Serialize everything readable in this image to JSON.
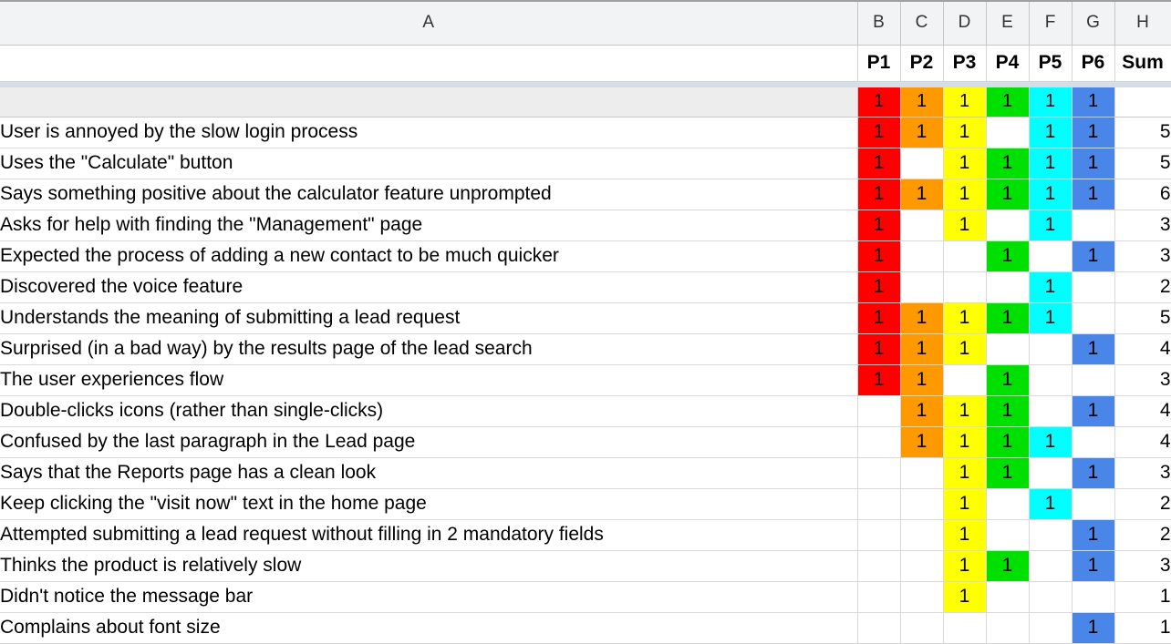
{
  "spreadsheet": {
    "column_letters": [
      "A",
      "B",
      "C",
      "D",
      "E",
      "F",
      "G",
      "H"
    ],
    "headers": {
      "label_column": "",
      "participants": [
        "P1",
        "P2",
        "P3",
        "P4",
        "P5",
        "P6"
      ],
      "sum": "Sum"
    },
    "legend_row": {
      "label": "",
      "marks": [
        "1",
        "1",
        "1",
        "1",
        "1",
        "1"
      ],
      "sum": ""
    },
    "mark_value": "1",
    "colors": {
      "p1": "#ff0000",
      "p2": "#ff9900",
      "p3": "#ffff00",
      "p4": "#00e000",
      "p5": "#00ffff",
      "p6": "#4a86e8",
      "column_header_bg": "#f1f3f4",
      "band": "#d8dce5",
      "legend_label_bg": "#ededed",
      "grid_line": "#d9d9d9"
    },
    "rows": [
      {
        "label": "User is annoyed by the slow login process",
        "marks": [
          "1",
          "1",
          "1",
          "",
          "1",
          "1"
        ],
        "sum": "5"
      },
      {
        "label": "Uses the \"Calculate\" button",
        "marks": [
          "1",
          "",
          "1",
          "1",
          "1",
          "1"
        ],
        "sum": "5"
      },
      {
        "label": "Says something positive about the calculator feature unprompted",
        "marks": [
          "1",
          "1",
          "1",
          "1",
          "1",
          "1"
        ],
        "sum": "6"
      },
      {
        "label": "Asks for help with finding the \"Management\" page",
        "marks": [
          "1",
          "",
          "1",
          "",
          "1",
          ""
        ],
        "sum": "3"
      },
      {
        "label": "Expected the process of adding a new contact to be much quicker",
        "marks": [
          "1",
          "",
          "",
          "1",
          "",
          "1"
        ],
        "sum": "3"
      },
      {
        "label": "Discovered the voice feature",
        "marks": [
          "1",
          "",
          "",
          "",
          "1",
          ""
        ],
        "sum": "2"
      },
      {
        "label": "Understands the meaning of submitting a lead request",
        "marks": [
          "1",
          "1",
          "1",
          "1",
          "1",
          ""
        ],
        "sum": "5"
      },
      {
        "label": "Surprised (in a bad way) by the results page of the lead search",
        "marks": [
          "1",
          "1",
          "1",
          "",
          "",
          "1"
        ],
        "sum": "4"
      },
      {
        "label": "The user experiences flow",
        "marks": [
          "1",
          "1",
          "",
          "1",
          "",
          ""
        ],
        "sum": "3"
      },
      {
        "label": "Double-clicks icons (rather than single-clicks)",
        "marks": [
          "",
          "1",
          "1",
          "1",
          "",
          "1"
        ],
        "sum": "4"
      },
      {
        "label": "Confused by the last paragraph in the Lead page",
        "marks": [
          "",
          "1",
          "1",
          "1",
          "1",
          ""
        ],
        "sum": "4"
      },
      {
        "label": "Says that the Reports page has a clean look",
        "marks": [
          "",
          "",
          "1",
          "1",
          "",
          "1"
        ],
        "sum": "3"
      },
      {
        "label": "Keep clicking the \"visit now\" text in the home page",
        "marks": [
          "",
          "",
          "1",
          "",
          "1",
          ""
        ],
        "sum": "2"
      },
      {
        "label": "Attempted submitting a lead request without filling in 2 mandatory fields",
        "marks": [
          "",
          "",
          "1",
          "",
          "",
          "1"
        ],
        "sum": "2"
      },
      {
        "label": "Thinks the product is relatively slow",
        "marks": [
          "",
          "",
          "1",
          "1",
          "",
          "1"
        ],
        "sum": "3"
      },
      {
        "label": "Didn't notice the message bar",
        "marks": [
          "",
          "",
          "1",
          "",
          "",
          ""
        ],
        "sum": "1"
      },
      {
        "label": "Complains about font size",
        "marks": [
          "",
          "",
          "",
          "",
          "",
          "1"
        ],
        "sum": "1"
      }
    ]
  }
}
